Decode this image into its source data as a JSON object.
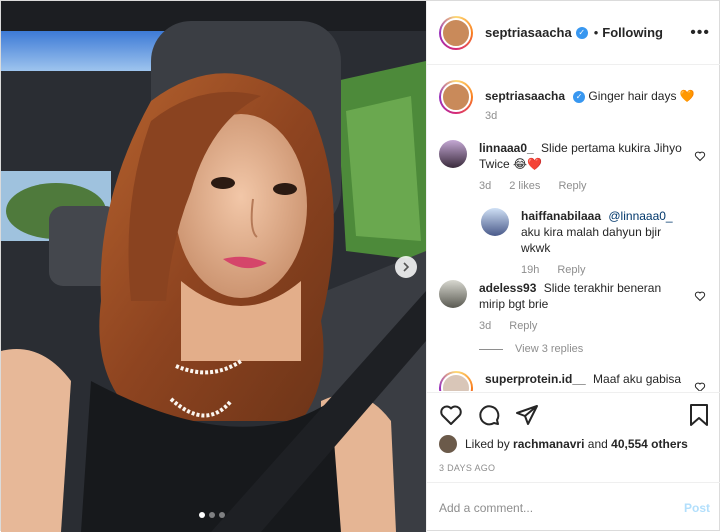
{
  "post_header": {
    "username": "septriasaacha",
    "separator": "•",
    "follow_status": "Following",
    "more_icon": "ellipsis-icon"
  },
  "caption": {
    "username": "septriasaacha",
    "text": "Ginger hair days 🧡",
    "time": "3d"
  },
  "comments": [
    {
      "username": "linnaaa0_",
      "text": "Slide pertama kukira Jihyo Twice 😂❤️",
      "time": "3d",
      "likes": "2 likes",
      "reply": "Reply"
    },
    {
      "username": "haiffanabilaaa",
      "mention": "@linnaaa0_",
      "text": " aku kira malah dahyun bjir wkwk",
      "time": "19h",
      "reply": "Reply"
    },
    {
      "username": "adeless93",
      "text": "Slide terakhir beneran mirip bgt brie",
      "time": "3d",
      "reply": "Reply"
    },
    {
      "username": "superprotein.id__",
      "text": "Maaf aku gabisa"
    }
  ],
  "view_replies": "View 3 replies",
  "likes": {
    "prefix": "Liked by",
    "user": "rachmanavri",
    "and": "and",
    "count": "40,554 others"
  },
  "time_ago": "3 DAYS AGO",
  "add_comment": {
    "placeholder": "Add a comment...",
    "post_label": "Post"
  },
  "carousel": {
    "slides": 3,
    "active": 0
  },
  "colors": {
    "link": "#00376b",
    "verified": "#3897f0",
    "post_disabled": "#b2dffc",
    "muted": "#8e8e8e"
  }
}
